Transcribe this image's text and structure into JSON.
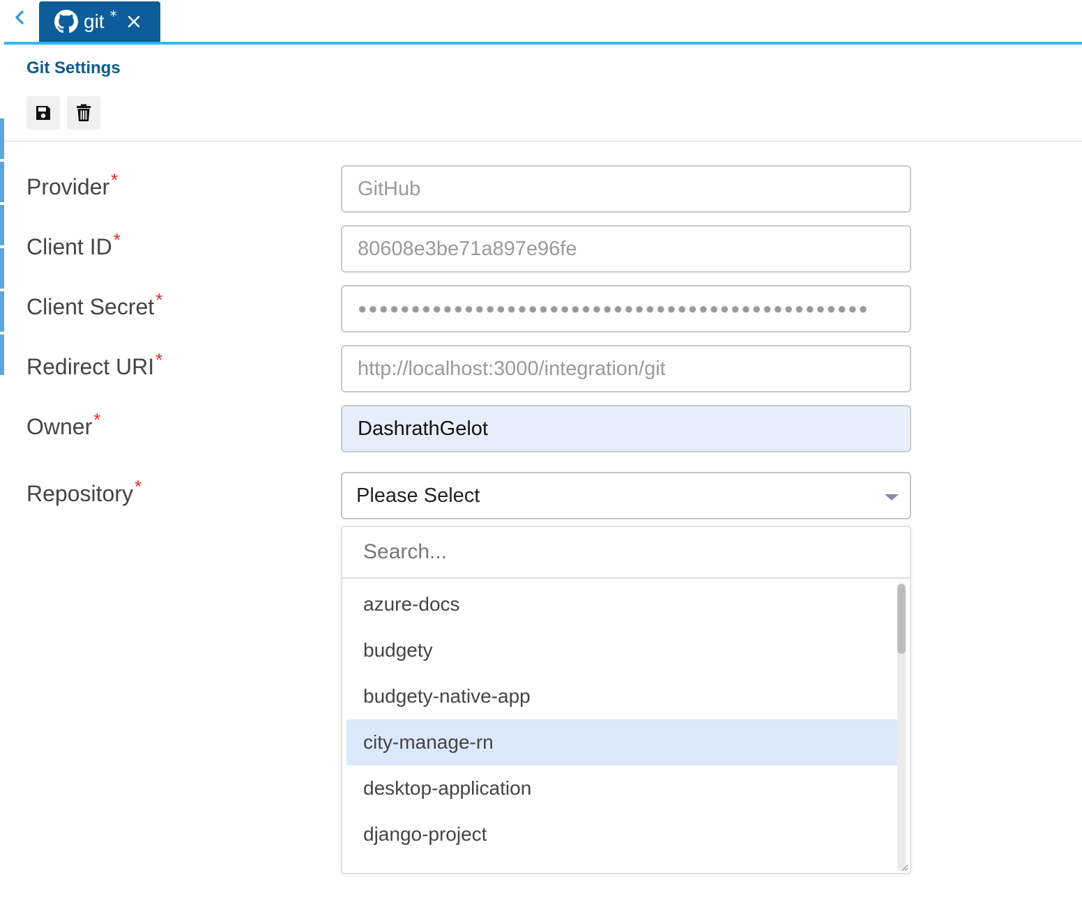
{
  "tabbar": {
    "back_icon": "chevron-left-icon",
    "tab": {
      "icon": "github-icon",
      "label": "git",
      "dirty_mark": "*",
      "close_icon": "close-icon"
    }
  },
  "page": {
    "title": "Git Settings"
  },
  "toolbar": {
    "save_icon": "floppy-disk-icon",
    "delete_icon": "trash-icon"
  },
  "form": {
    "required_mark": "*",
    "provider": {
      "label": "Provider",
      "value": "GitHub"
    },
    "client_id": {
      "label": "Client ID",
      "value": "80608e3be71a897e96fe"
    },
    "client_secret": {
      "label": "Client Secret",
      "value": "●●●●●●●●●●●●●●●●●●●●●●●●●●●●●●●●●●●●●●●●●●●●●●●●"
    },
    "redirect_uri": {
      "label": "Redirect URI",
      "value": "http://localhost:3000/integration/git"
    },
    "owner": {
      "label": "Owner",
      "value": "DashrathGelot"
    },
    "repository": {
      "label": "Repository",
      "selected": "Please Select"
    }
  },
  "dropdown": {
    "search_placeholder": "Search...",
    "items": [
      {
        "label": "azure-docs"
      },
      {
        "label": "budgety"
      },
      {
        "label": "budgety-native-app"
      },
      {
        "label": "city-manage-rn"
      },
      {
        "label": "desktop-application"
      },
      {
        "label": "django-project"
      }
    ],
    "highlighted_item": "city-manage-rn"
  },
  "colors": {
    "tab_bg": "#0c5d9a",
    "accent_line": "#2db7f5",
    "title": "#0d5a8c",
    "required": "#e02a2a",
    "focused_field_bg": "#e6eefb",
    "highlight_row": "#dce8fb"
  }
}
